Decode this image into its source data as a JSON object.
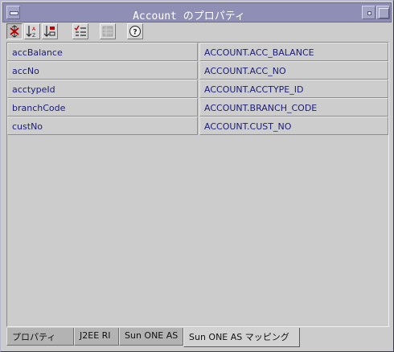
{
  "window": {
    "title": "Account のプロパティ"
  },
  "toolbar": {
    "buttons": [
      {
        "name": "unsorted",
        "icon": "unsort-icon",
        "pressed": true
      },
      {
        "name": "sort-by-name",
        "icon": "sort-by-name-icon",
        "pressed": false
      },
      {
        "name": "sort-by-type",
        "icon": "sort-by-type-icon",
        "pressed": false
      },
      {
        "name": "show-editable",
        "icon": "checklist-icon",
        "pressed": false
      },
      {
        "name": "customize",
        "icon": "grid-icon",
        "disabled": true
      },
      {
        "name": "help",
        "icon": "help-icon",
        "pressed": false
      }
    ]
  },
  "properties": [
    {
      "name": "accBalance",
      "value": "ACCOUNT.ACC_BALANCE"
    },
    {
      "name": "accNo",
      "value": "ACCOUNT.ACC_NO"
    },
    {
      "name": "acctypeId",
      "value": "ACCOUNT.ACCTYPE_ID"
    },
    {
      "name": "branchCode",
      "value": "ACCOUNT.BRANCH_CODE"
    },
    {
      "name": "custNo",
      "value": "ACCOUNT.CUST_NO"
    }
  ],
  "tabs": [
    {
      "label": "プロパティ",
      "active": false
    },
    {
      "label": "J2EE RI",
      "active": false
    },
    {
      "label": "Sun ONE AS",
      "active": false
    },
    {
      "label": "Sun ONE AS マッピング",
      "active": true
    }
  ],
  "colors": {
    "titlebar": "#8f8fb5",
    "value_text": "#1c1c7a",
    "desktop": "#5c5f7c"
  }
}
